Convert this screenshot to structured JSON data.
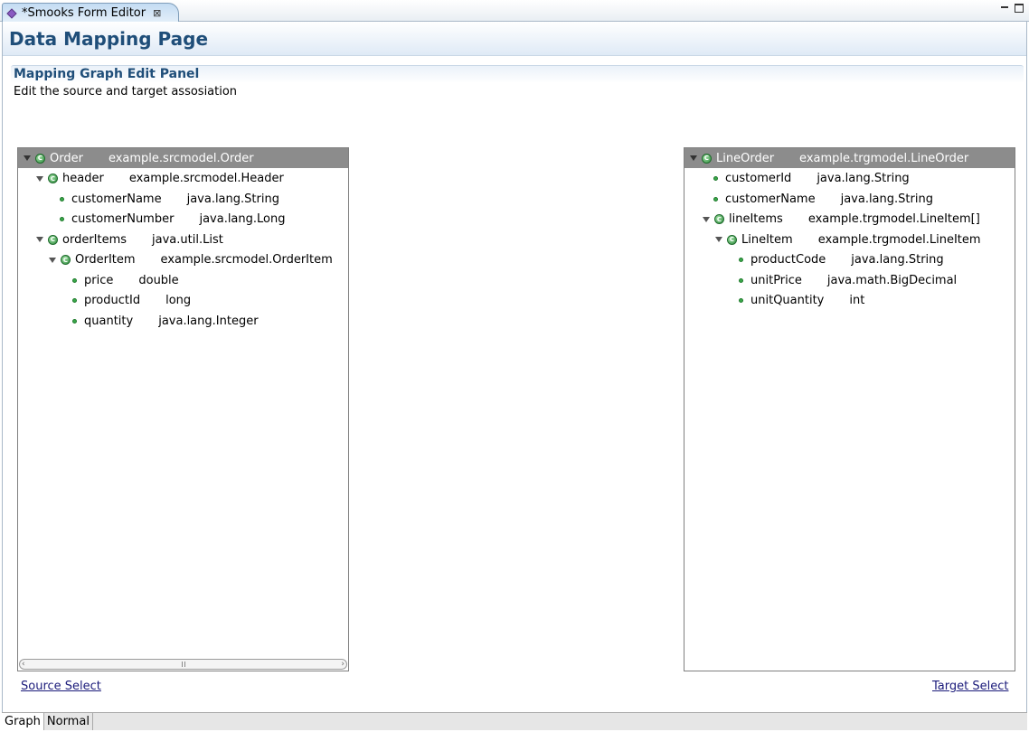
{
  "editor_tab": {
    "label": "*Smooks Form Editor",
    "close_glyph": "⊠"
  },
  "page": {
    "title": "Data Mapping Page"
  },
  "section": {
    "title": "Mapping Graph Edit Panel",
    "description": "Edit the source and target assosiation"
  },
  "source_tree": {
    "rows": [
      {
        "name": "Order",
        "type": "example.srcmodel.Order",
        "kind": "class",
        "expanded": true
      },
      {
        "name": "header",
        "type": "example.srcmodel.Header",
        "kind": "class",
        "expanded": true
      },
      {
        "name": "customerName",
        "type": "java.lang.String",
        "kind": "field"
      },
      {
        "name": "customerNumber",
        "type": "java.lang.Long",
        "kind": "field"
      },
      {
        "name": "orderItems",
        "type": "java.util.List",
        "kind": "class",
        "expanded": true
      },
      {
        "name": "OrderItem",
        "type": "example.srcmodel.OrderItem",
        "kind": "class",
        "expanded": true
      },
      {
        "name": "price",
        "type": "double",
        "kind": "field"
      },
      {
        "name": "productId",
        "type": "long",
        "kind": "field"
      },
      {
        "name": "quantity",
        "type": "java.lang.Integer",
        "kind": "field"
      }
    ]
  },
  "target_tree": {
    "rows": [
      {
        "name": "LineOrder",
        "type": "example.trgmodel.LineOrder",
        "kind": "class",
        "expanded": true
      },
      {
        "name": "customerId",
        "type": "java.lang.String",
        "kind": "field"
      },
      {
        "name": "customerName",
        "type": "java.lang.String",
        "kind": "field"
      },
      {
        "name": "lineItems",
        "type": "example.trgmodel.LineItem[]",
        "kind": "class",
        "expanded": true
      },
      {
        "name": "LineItem",
        "type": "example.trgmodel.LineItem",
        "kind": "class",
        "expanded": true
      },
      {
        "name": "productCode",
        "type": "java.lang.String",
        "kind": "field"
      },
      {
        "name": "unitPrice",
        "type": "java.math.BigDecimal",
        "kind": "field"
      },
      {
        "name": "unitQuantity",
        "type": "int",
        "kind": "field"
      }
    ]
  },
  "links": {
    "source_select": "Source Select",
    "target_select": "Target Select"
  },
  "page_tabs": [
    {
      "label": "Graph",
      "active": true
    },
    {
      "label": "Normal",
      "active": false
    }
  ],
  "colors": {
    "title": "#1f4e79",
    "tree_root_bg": "#8c8c8c",
    "class_icon": "#2e8b3e",
    "link": "#1a1a7a"
  }
}
